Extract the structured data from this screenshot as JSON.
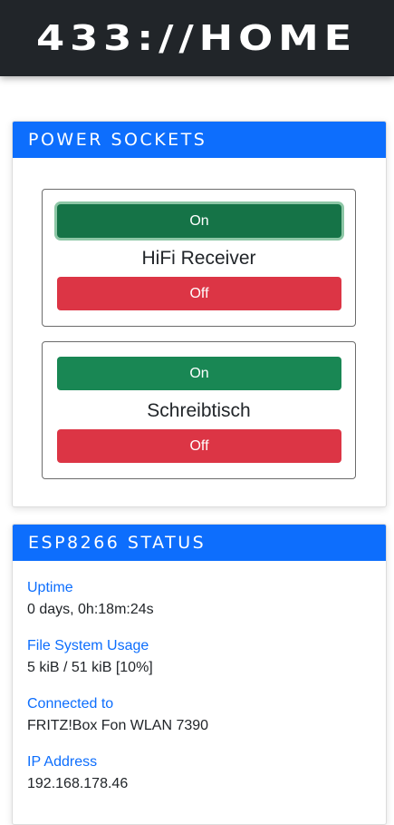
{
  "header": {
    "title": "433://HOME"
  },
  "power": {
    "title": "POWER SOCKETS",
    "sockets": [
      {
        "name": "HiFi Receiver",
        "on_label": "On",
        "off_label": "Off"
      },
      {
        "name": "Schreibtisch",
        "on_label": "On",
        "off_label": "Off"
      }
    ]
  },
  "status": {
    "title": "ESP8266 STATUS",
    "items": [
      {
        "label": "Uptime",
        "value": "0 days, 0h:18m:24s"
      },
      {
        "label": "File System Usage",
        "value": "5 kiB / 51 kiB [10%]"
      },
      {
        "label": "Connected to",
        "value": "FRITZ!Box Fon WLAN 7390"
      },
      {
        "label": "IP Address",
        "value": "192.168.178.46"
      }
    ]
  },
  "colors": {
    "accent": "#0d6efd",
    "on": "#198754",
    "off": "#dc3545",
    "topbar": "#212529"
  }
}
